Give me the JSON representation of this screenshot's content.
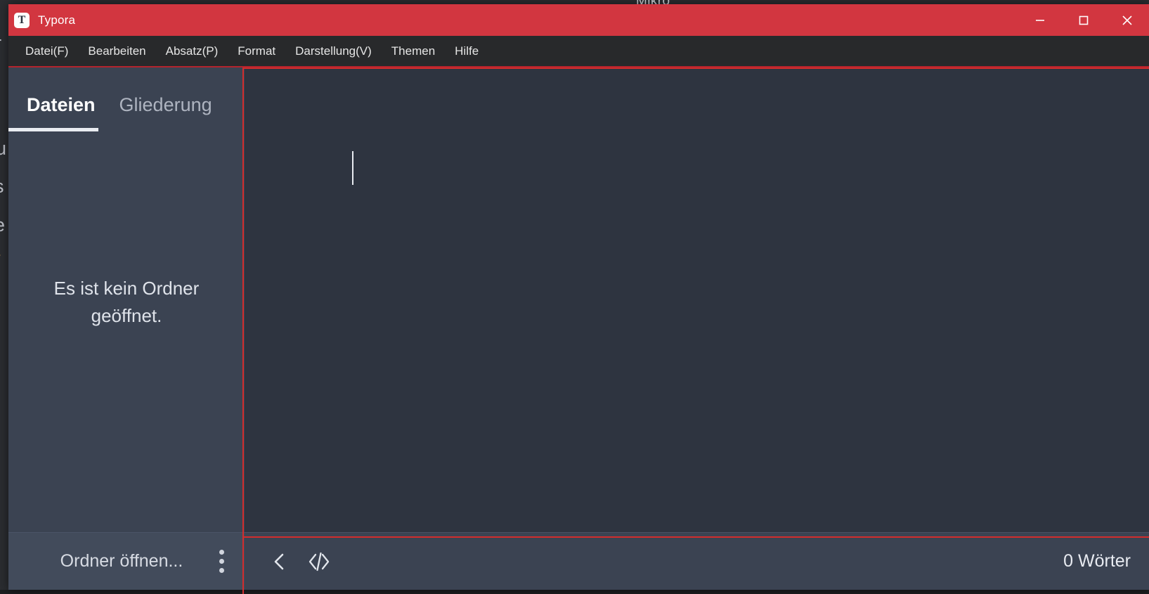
{
  "background_window": {
    "title_fragment": "Mikro",
    "left_fragments": [
      "r",
      "u",
      "s",
      "e",
      "/"
    ]
  },
  "titlebar": {
    "logo_glyph": "T",
    "app_title": "Typora",
    "controls": [
      {
        "name": "minimize",
        "label": "—"
      },
      {
        "name": "maximize",
        "label": "□"
      },
      {
        "name": "close",
        "label": "✕"
      }
    ]
  },
  "menubar": {
    "items": [
      {
        "label": "Datei(F)"
      },
      {
        "label": "Bearbeiten"
      },
      {
        "label": "Absatz(P)"
      },
      {
        "label": "Format"
      },
      {
        "label": "Darstellung(V)"
      },
      {
        "label": "Themen"
      },
      {
        "label": "Hilfe"
      }
    ]
  },
  "sidebar": {
    "tabs": [
      {
        "label": "Dateien",
        "active": true
      },
      {
        "label": "Gliederung",
        "active": false
      }
    ],
    "empty_message": "Es ist kein Ordner geöffnet.",
    "footer": {
      "open_folder_label": "Ordner öffnen...",
      "menu_icon": "kebab-menu-icon"
    }
  },
  "editor": {
    "content": "",
    "caret_visible": true
  },
  "statusbar": {
    "back_icon": "chevron-left-icon",
    "source_icon": "source-code-icon",
    "word_count": "0 Wörter"
  },
  "colors": {
    "titlebar_red": "#d23640",
    "focus_outline_red": "#d22d2d",
    "editor_bg": "#2e3440",
    "sidebar_bg": "#3b4352",
    "menubar_bg": "#28292b"
  }
}
